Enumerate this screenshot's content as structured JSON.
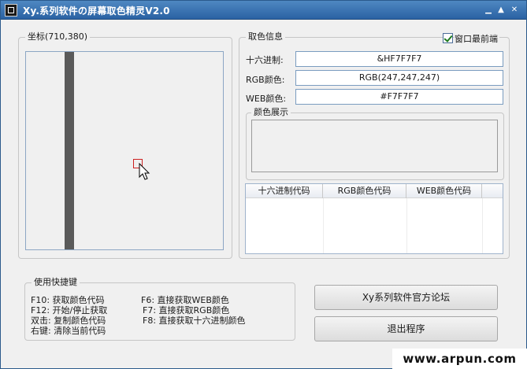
{
  "window": {
    "title": "Xy.系列软件の屏幕取色精灵V2.0"
  },
  "coords_group": {
    "label": "坐标(710,380)"
  },
  "color_group": {
    "label": "取色信息",
    "topmost_label": "窗口最前端",
    "topmost_checked": true,
    "hex_label": "十六进制:",
    "hex_value": "&HF7F7F7",
    "rgb_label": "RGB颜色:",
    "rgb_value": "RGB(247,247,247)",
    "web_label": "WEB颜色:",
    "web_value": "#F7F7F7",
    "preview_label": "颜色展示",
    "preview_color": "#f0f0f0",
    "table_headers": [
      "十六进制代码",
      "RGB颜色代码",
      "WEB颜色代码"
    ]
  },
  "shortcuts": {
    "label": "使用快捷键",
    "items": [
      "F10: 获取颜色代码",
      "F12: 开始/停止获取",
      "双击: 复制颜色代码",
      "右键: 清除当前代码",
      "F6: 直接获取WEB颜色",
      "F7: 直接获取RGB颜色",
      "F8: 直接获取十六进制颜色"
    ]
  },
  "buttons": {
    "forum": "Xy系列软件官方论坛",
    "exit": "退出程序"
  },
  "watermark": "www.arpun.com"
}
